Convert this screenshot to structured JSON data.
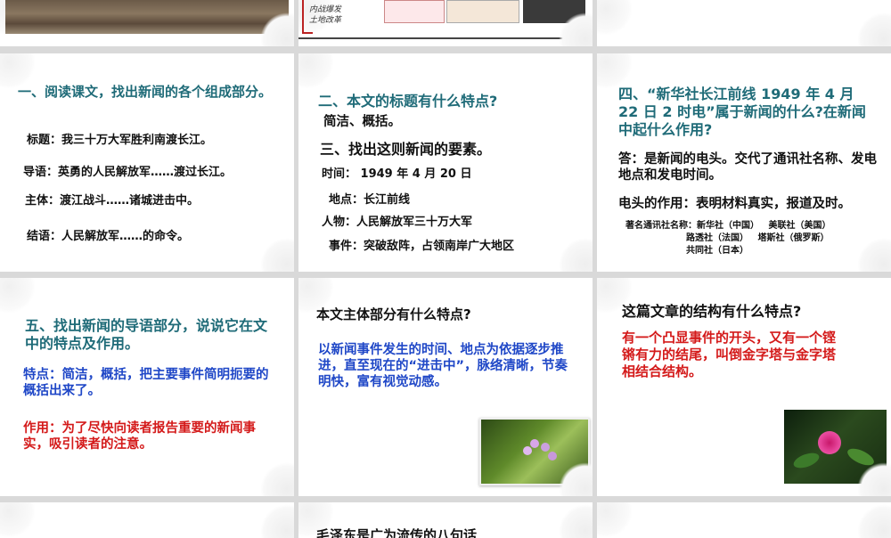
{
  "s1": {
    "q": "一、阅读课文，找出新闻的各个组成部分。",
    "items": [
      "标题：我三十万大军胜利南渡长江。",
      "导语：英勇的人民解放军……渡过长江。",
      "主体：渡江战斗……诸城进击中。",
      "结语：人民解放军……的命令。"
    ]
  },
  "s2": {
    "q1": "二、本文的标题有什么特点?",
    "a1": "简洁、概括。",
    "q2": "三、找出这则新闻的要素。",
    "items": [
      "时间： 1949 年 4 月 20 日",
      "地点：长江前线",
      "人物：人民解放军三十万大军",
      "事件：突破敌阵，占领南岸广大地区"
    ]
  },
  "s3": {
    "q": "四、“新华社长江前线 1949 年 4 月 22 日 2 时电”属于新闻的什么?在新闻中起什么作用?",
    "a1": "答：是新闻的电头。交代了通讯社名称、发电地点和发电时间。",
    "a2": "电头的作用：表明材料真实，报道及时。",
    "agencies": [
      "著名通讯社名称：新华社（中国）   美联社（美国）",
      "路透社（法国）   塔斯社（俄罗斯）",
      "共同社（日本）"
    ]
  },
  "s4": {
    "q": "五、找出新闻的导语部分，说说它在文中的特点及作用。",
    "a1": "特点：简洁，概括，把主要事件简明扼要的概括出来了。",
    "a2": "作用：为了尽快向读者报告重要的新闻事实，吸引读者的注意。"
  },
  "s5": {
    "q": "本文主体部分有什么特点?",
    "a": "以新闻事件发生的时间、地点为依据逐步推进，直至现在的“进击中”，脉络清晰，节奏明快，富有视觉动感。"
  },
  "s6": {
    "q": "这篇文章的结构有什么特点?",
    "a": "有一个凸显事件的开头，又有一个铿锵有力的结尾，叫倒金字塔与金字塔相结合结构。"
  },
  "top": {
    "map_labels": [
      "内战爆发",
      "土地改革"
    ]
  },
  "s8": {
    "q": "毛泽东是广为流传的八句话"
  }
}
